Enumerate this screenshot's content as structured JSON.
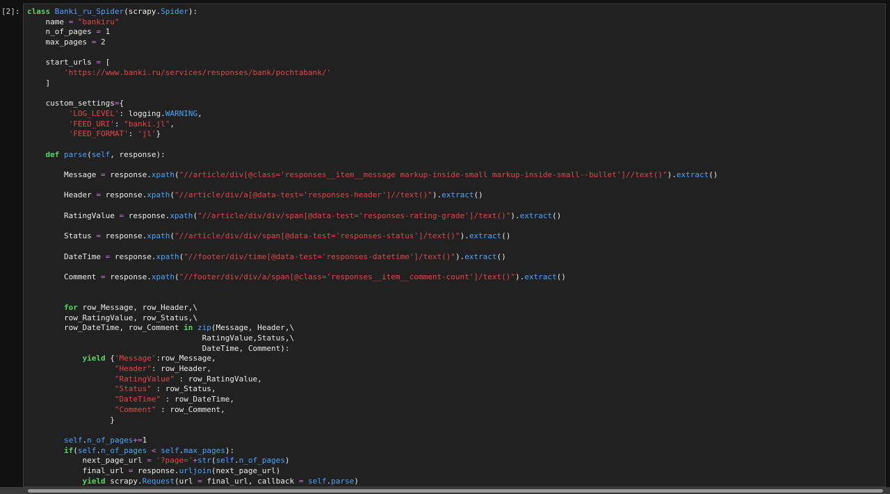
{
  "prompt": "[2]:",
  "lines": [
    [
      {
        "t": "class ",
        "c": "kw"
      },
      {
        "t": "Banki_ru_Spider",
        "c": "cls"
      },
      {
        "t": "(scrapy.",
        "c": "txt"
      },
      {
        "t": "Spider",
        "c": "attr"
      },
      {
        "t": "):",
        "c": "txt"
      }
    ],
    [
      {
        "t": "    name ",
        "c": "txt"
      },
      {
        "t": "=",
        "c": "op"
      },
      {
        "t": " ",
        "c": "txt"
      },
      {
        "t": "\"bankiru\"",
        "c": "str"
      }
    ],
    [
      {
        "t": "    n_of_pages ",
        "c": "txt"
      },
      {
        "t": "=",
        "c": "op"
      },
      {
        "t": " 1",
        "c": "txt"
      }
    ],
    [
      {
        "t": "    max_pages ",
        "c": "txt"
      },
      {
        "t": "=",
        "c": "op"
      },
      {
        "t": " 2",
        "c": "txt"
      }
    ],
    [],
    [
      {
        "t": "    start_urls ",
        "c": "txt"
      },
      {
        "t": "=",
        "c": "op"
      },
      {
        "t": " [",
        "c": "txt"
      }
    ],
    [
      {
        "t": "        ",
        "c": "txt"
      },
      {
        "t": "'https://www.banki.ru/services/responses/bank/pochtabank/'",
        "c": "str"
      }
    ],
    [
      {
        "t": "    ]",
        "c": "txt"
      }
    ],
    [],
    [
      {
        "t": "    custom_settings",
        "c": "txt"
      },
      {
        "t": "=",
        "c": "op"
      },
      {
        "t": "{",
        "c": "txt"
      }
    ],
    [
      {
        "t": "         ",
        "c": "txt"
      },
      {
        "t": "'LOG_LEVEL'",
        "c": "str"
      },
      {
        "t": ": logging.",
        "c": "txt"
      },
      {
        "t": "WARNING",
        "c": "attr"
      },
      {
        "t": ",",
        "c": "txt"
      }
    ],
    [
      {
        "t": "         ",
        "c": "txt"
      },
      {
        "t": "'FEED_URI'",
        "c": "str"
      },
      {
        "t": ": ",
        "c": "txt"
      },
      {
        "t": "\"banki.jl\"",
        "c": "str"
      },
      {
        "t": ",",
        "c": "txt"
      }
    ],
    [
      {
        "t": "         ",
        "c": "txt"
      },
      {
        "t": "'FEED_FORMAT'",
        "c": "str"
      },
      {
        "t": ": ",
        "c": "txt"
      },
      {
        "t": "'jl'",
        "c": "str"
      },
      {
        "t": "}",
        "c": "txt"
      }
    ],
    [],
    [
      {
        "t": "    ",
        "c": "txt"
      },
      {
        "t": "def ",
        "c": "kw"
      },
      {
        "t": "parse",
        "c": "cls"
      },
      {
        "t": "(",
        "c": "txt"
      },
      {
        "t": "self",
        "c": "attr"
      },
      {
        "t": ", response):",
        "c": "txt"
      }
    ],
    [],
    [
      {
        "t": "        Message ",
        "c": "txt"
      },
      {
        "t": "=",
        "c": "op"
      },
      {
        "t": " response.",
        "c": "txt"
      },
      {
        "t": "xpath",
        "c": "attr"
      },
      {
        "t": "(",
        "c": "txt"
      },
      {
        "t": "\"//article/div[@class='responses__item__message markup-inside-small markup-inside-small--bullet']//text()\"",
        "c": "str"
      },
      {
        "t": ").",
        "c": "txt"
      },
      {
        "t": "extract",
        "c": "attr"
      },
      {
        "t": "()",
        "c": "txt"
      }
    ],
    [],
    [
      {
        "t": "        Header ",
        "c": "txt"
      },
      {
        "t": "=",
        "c": "op"
      },
      {
        "t": " response.",
        "c": "txt"
      },
      {
        "t": "xpath",
        "c": "attr"
      },
      {
        "t": "(",
        "c": "txt"
      },
      {
        "t": "\"//article/div/a[@data-test='responses-header']//text()\"",
        "c": "str"
      },
      {
        "t": ").",
        "c": "txt"
      },
      {
        "t": "extract",
        "c": "attr"
      },
      {
        "t": "()",
        "c": "txt"
      }
    ],
    [],
    [
      {
        "t": "        RatingValue ",
        "c": "txt"
      },
      {
        "t": "=",
        "c": "op"
      },
      {
        "t": " response.",
        "c": "txt"
      },
      {
        "t": "xpath",
        "c": "attr"
      },
      {
        "t": "(",
        "c": "txt"
      },
      {
        "t": "\"//article/div/div/span[@data-test='responses-rating-grade']/text()\"",
        "c": "str"
      },
      {
        "t": ").",
        "c": "txt"
      },
      {
        "t": "extract",
        "c": "attr"
      },
      {
        "t": "()",
        "c": "txt"
      }
    ],
    [],
    [
      {
        "t": "        Status ",
        "c": "txt"
      },
      {
        "t": "=",
        "c": "op"
      },
      {
        "t": " response.",
        "c": "txt"
      },
      {
        "t": "xpath",
        "c": "attr"
      },
      {
        "t": "(",
        "c": "txt"
      },
      {
        "t": "\"//article/div/div/span[@data-test='responses-status']/text()\"",
        "c": "str"
      },
      {
        "t": ").",
        "c": "txt"
      },
      {
        "t": "extract",
        "c": "attr"
      },
      {
        "t": "()",
        "c": "txt"
      }
    ],
    [],
    [
      {
        "t": "        DateTime ",
        "c": "txt"
      },
      {
        "t": "=",
        "c": "op"
      },
      {
        "t": " response.",
        "c": "txt"
      },
      {
        "t": "xpath",
        "c": "attr"
      },
      {
        "t": "(",
        "c": "txt"
      },
      {
        "t": "\"//footer/div/time[@data-test='responses-datetime']/text()\"",
        "c": "str"
      },
      {
        "t": ").",
        "c": "txt"
      },
      {
        "t": "extract",
        "c": "attr"
      },
      {
        "t": "()",
        "c": "txt"
      }
    ],
    [],
    [
      {
        "t": "        Comment ",
        "c": "txt"
      },
      {
        "t": "=",
        "c": "op"
      },
      {
        "t": " response.",
        "c": "txt"
      },
      {
        "t": "xpath",
        "c": "attr"
      },
      {
        "t": "(",
        "c": "txt"
      },
      {
        "t": "\"//footer/div/div/a/span[@class='responses__item__comment-count']/text()\"",
        "c": "str"
      },
      {
        "t": ").",
        "c": "txt"
      },
      {
        "t": "extract",
        "c": "attr"
      },
      {
        "t": "()",
        "c": "txt"
      }
    ],
    [],
    [],
    [
      {
        "t": "        ",
        "c": "txt"
      },
      {
        "t": "for ",
        "c": "kw"
      },
      {
        "t": "row_Message, row_Header,\\",
        "c": "txt"
      }
    ],
    [
      {
        "t": "        row_RatingValue, row_Status,\\",
        "c": "txt"
      }
    ],
    [
      {
        "t": "        row_DateTime, row_Comment ",
        "c": "txt"
      },
      {
        "t": "in ",
        "c": "kw"
      },
      {
        "t": "zip",
        "c": "attr"
      },
      {
        "t": "(Message, Header,\\",
        "c": "txt"
      }
    ],
    [
      {
        "t": "                                      RatingValue,Status,\\",
        "c": "txt"
      }
    ],
    [
      {
        "t": "                                      DateTime, Comment):",
        "c": "txt"
      }
    ],
    [
      {
        "t": "            ",
        "c": "txt"
      },
      {
        "t": "yield ",
        "c": "kw"
      },
      {
        "t": "{",
        "c": "txt"
      },
      {
        "t": "'Message'",
        "c": "str"
      },
      {
        "t": ":row_Message,",
        "c": "txt"
      }
    ],
    [
      {
        "t": "                   ",
        "c": "txt"
      },
      {
        "t": "\"Header\"",
        "c": "str"
      },
      {
        "t": ": row_Header,",
        "c": "txt"
      }
    ],
    [
      {
        "t": "                   ",
        "c": "txt"
      },
      {
        "t": "\"RatingValue\"",
        "c": "str"
      },
      {
        "t": " : row_RatingValue,",
        "c": "txt"
      }
    ],
    [
      {
        "t": "                   ",
        "c": "txt"
      },
      {
        "t": "\"Status\"",
        "c": "str"
      },
      {
        "t": " : row_Status,",
        "c": "txt"
      }
    ],
    [
      {
        "t": "                   ",
        "c": "txt"
      },
      {
        "t": "\"DateTime\"",
        "c": "str"
      },
      {
        "t": " : row_DateTime,",
        "c": "txt"
      }
    ],
    [
      {
        "t": "                   ",
        "c": "txt"
      },
      {
        "t": "\"Comment\"",
        "c": "str"
      },
      {
        "t": " : row_Comment,",
        "c": "txt"
      }
    ],
    [
      {
        "t": "                  }",
        "c": "txt"
      }
    ],
    [],
    [
      {
        "t": "        ",
        "c": "txt"
      },
      {
        "t": "self",
        "c": "attr"
      },
      {
        "t": ".",
        "c": "txt"
      },
      {
        "t": "n_of_pages",
        "c": "attr"
      },
      {
        "t": "+=",
        "c": "op"
      },
      {
        "t": "1",
        "c": "txt"
      }
    ],
    [
      {
        "t": "        ",
        "c": "txt"
      },
      {
        "t": "if",
        "c": "kw"
      },
      {
        "t": "(",
        "c": "txt"
      },
      {
        "t": "self",
        "c": "attr"
      },
      {
        "t": ".",
        "c": "txt"
      },
      {
        "t": "n_of_pages",
        "c": "attr"
      },
      {
        "t": " ",
        "c": "txt"
      },
      {
        "t": "<",
        "c": "op"
      },
      {
        "t": " ",
        "c": "txt"
      },
      {
        "t": "self",
        "c": "attr"
      },
      {
        "t": ".",
        "c": "txt"
      },
      {
        "t": "max_pages",
        "c": "attr"
      },
      {
        "t": "):",
        "c": "txt"
      }
    ],
    [
      {
        "t": "            next_page_url ",
        "c": "txt"
      },
      {
        "t": "=",
        "c": "op"
      },
      {
        "t": " ",
        "c": "txt"
      },
      {
        "t": "'?page='",
        "c": "str"
      },
      {
        "t": "+",
        "c": "op"
      },
      {
        "t": "str",
        "c": "attr"
      },
      {
        "t": "(",
        "c": "txt"
      },
      {
        "t": "self",
        "c": "attr"
      },
      {
        "t": ".",
        "c": "txt"
      },
      {
        "t": "n_of_pages",
        "c": "attr"
      },
      {
        "t": ")",
        "c": "txt"
      }
    ],
    [
      {
        "t": "            final_url ",
        "c": "txt"
      },
      {
        "t": "=",
        "c": "op"
      },
      {
        "t": " response.",
        "c": "txt"
      },
      {
        "t": "urljoin",
        "c": "attr"
      },
      {
        "t": "(next_page_url)",
        "c": "txt"
      }
    ],
    [
      {
        "t": "            ",
        "c": "txt"
      },
      {
        "t": "yield ",
        "c": "kw"
      },
      {
        "t": "scrapy.",
        "c": "txt"
      },
      {
        "t": "Request",
        "c": "attr"
      },
      {
        "t": "(url ",
        "c": "txt"
      },
      {
        "t": "=",
        "c": "op"
      },
      {
        "t": " final_url, callback ",
        "c": "txt"
      },
      {
        "t": "=",
        "c": "op"
      },
      {
        "t": " ",
        "c": "txt"
      },
      {
        "t": "self",
        "c": "attr"
      },
      {
        "t": ".",
        "c": "txt"
      },
      {
        "t": "parse",
        "c": "attr"
      },
      {
        "t": ")",
        "c": "txt"
      }
    ]
  ]
}
